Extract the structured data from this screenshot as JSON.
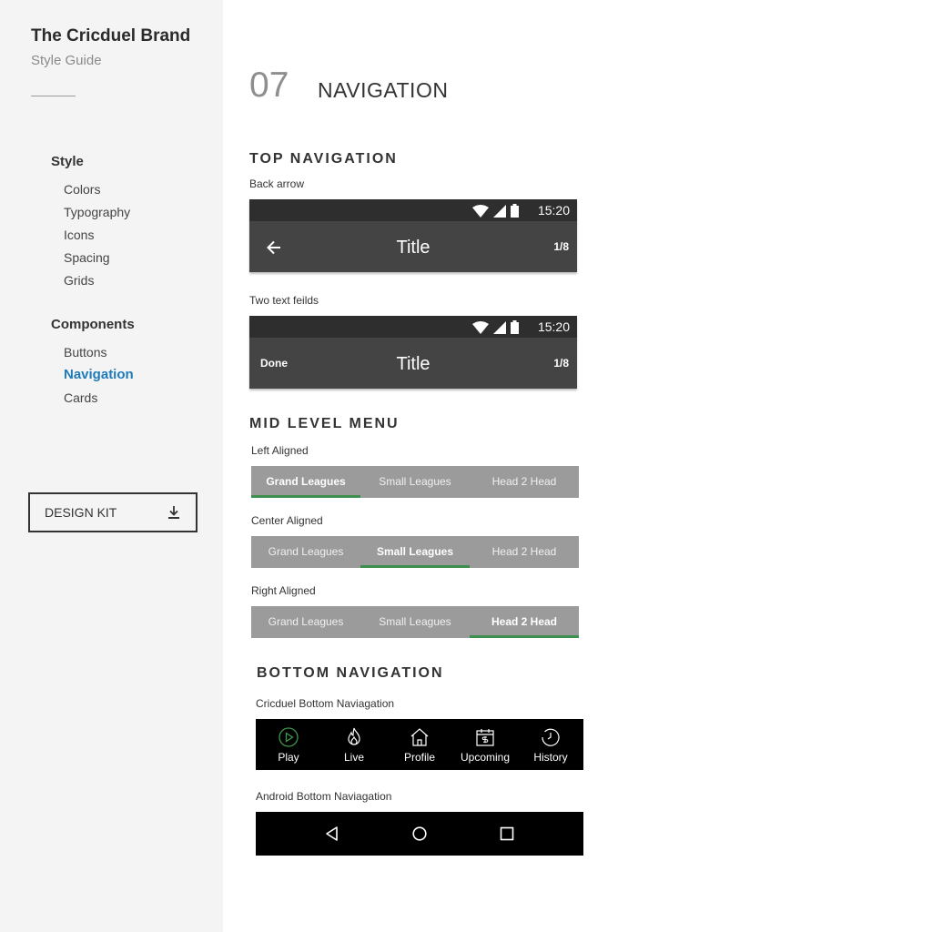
{
  "brand": {
    "title": "The Cricduel Brand",
    "subtitle": "Style Guide"
  },
  "sidebar": {
    "groups": [
      {
        "label": "Style",
        "items": [
          "Colors",
          "Typography",
          "Icons",
          "Spacing",
          "Grids"
        ]
      },
      {
        "label": "Components",
        "items": [
          "Buttons",
          "Navigation",
          "Cards"
        ]
      }
    ],
    "active_item": "Navigation",
    "design_kit_label": "DESIGN KIT"
  },
  "section": {
    "number": "07",
    "title": "NAVIGATION"
  },
  "top_navigation": {
    "heading": "TOP NAVIGATION",
    "examples": [
      {
        "caption": "Back arrow",
        "time": "15:20",
        "title": "Title",
        "count": "1/8",
        "left": "back-arrow"
      },
      {
        "caption": "Two text feilds",
        "time": "15:20",
        "title": "Title",
        "count": "1/8",
        "left_label": "Done"
      }
    ]
  },
  "mid_level_menu": {
    "heading": "MID LEVEL MENU",
    "tabs": [
      "Grand Leagues",
      "Small Leagues",
      "Head 2 Head"
    ],
    "variants": [
      {
        "caption": "Left Aligned",
        "active_index": 0
      },
      {
        "caption": "Center Aligned",
        "active_index": 1
      },
      {
        "caption": "Right Aligned",
        "active_index": 2
      }
    ],
    "accent_color": "#3d8e4f"
  },
  "bottom_navigation": {
    "heading": "BOTTOM NAVIGATION",
    "cricduel_caption": "Cricduel Bottom Naviagation",
    "items": [
      {
        "label": "Play",
        "icon": "play-circle-icon"
      },
      {
        "label": "Live",
        "icon": "flame-icon"
      },
      {
        "label": "Profile",
        "icon": "home-icon"
      },
      {
        "label": "Upcoming",
        "icon": "calendar-dollar-icon"
      },
      {
        "label": "History",
        "icon": "history-clock-icon"
      }
    ],
    "active_index": 0,
    "active_color": "#3d9a4f",
    "android_caption": "Android Bottom Naviagation",
    "android_buttons": [
      "back-triangle-icon",
      "home-circle-icon",
      "recents-square-icon"
    ]
  }
}
